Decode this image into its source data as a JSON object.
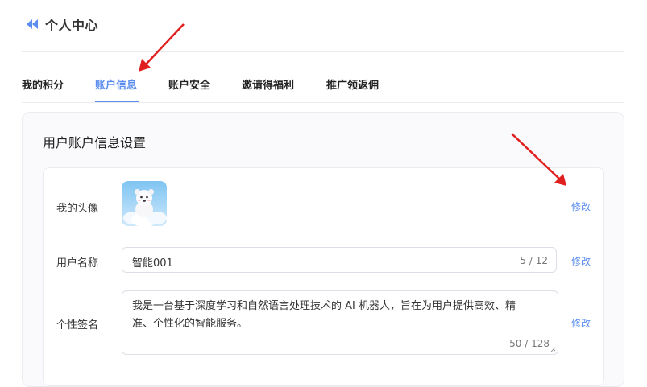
{
  "header": {
    "title": "个人中心",
    "back_icon": "double-chevron-left-icon",
    "accent": "#5b8def"
  },
  "tabs": [
    {
      "label": "我的积分",
      "active": false
    },
    {
      "label": "账户信息",
      "active": true
    },
    {
      "label": "账户安全",
      "active": false
    },
    {
      "label": "邀请得福利",
      "active": false
    },
    {
      "label": "推广领返佣",
      "active": false
    }
  ],
  "card": {
    "title": "用户账户信息设置",
    "avatar": {
      "label": "我的头像",
      "image": "white-bear-on-cloud-avatar",
      "modify": "修改"
    },
    "username": {
      "label": "用户名称",
      "value": "智能001",
      "counter": "5 / 12",
      "modify": "修改"
    },
    "signature": {
      "label": "个性签名",
      "value": "我是一台基于深度学习和自然语言处理技术的 AI 机器人，旨在为用户提供高效、精准、个性化的智能服务。",
      "counter": "50 / 128",
      "modify": "修改"
    }
  },
  "annotations": {
    "arrow_color": "#e0201e"
  }
}
